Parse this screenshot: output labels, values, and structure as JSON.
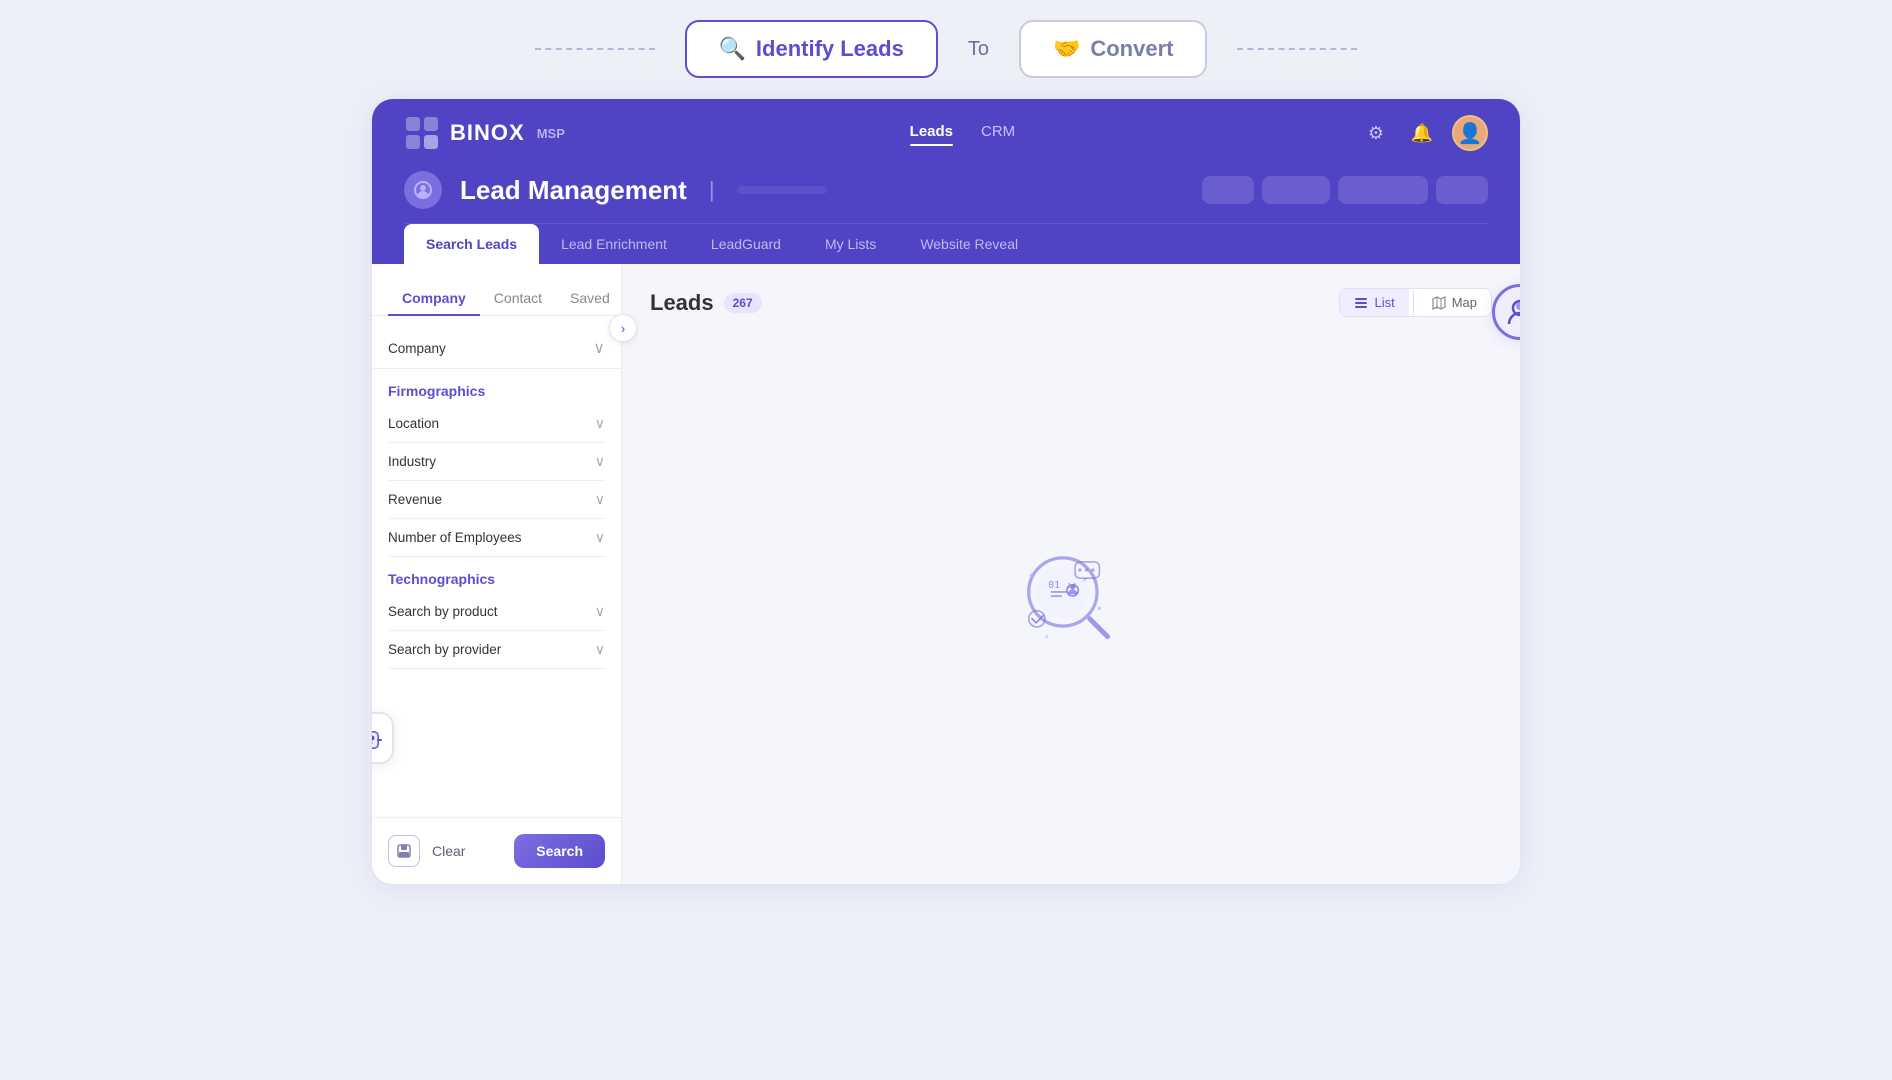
{
  "workflow": {
    "identify_label": "Identify Leads",
    "to_label": "To",
    "convert_label": "Convert"
  },
  "brand": {
    "name": "BINOX",
    "sub": "MSP"
  },
  "topnav": {
    "links": [
      {
        "label": "Leads",
        "active": true
      },
      {
        "label": "CRM",
        "active": false
      }
    ]
  },
  "page": {
    "title": "Lead Management",
    "divider": "|"
  },
  "subnav": {
    "items": [
      {
        "label": "Search Leads",
        "active": true
      },
      {
        "label": "Lead Enrichment",
        "active": false
      },
      {
        "label": "LeadGuard",
        "active": false
      },
      {
        "label": "My Lists",
        "active": false
      },
      {
        "label": "Website Reveal",
        "active": false
      }
    ]
  },
  "sidebar": {
    "tabs": [
      {
        "label": "Company",
        "active": true
      },
      {
        "label": "Contact",
        "active": false
      },
      {
        "label": "Saved",
        "active": false
      }
    ],
    "company_dropdown_label": "Company",
    "firmographics_title": "Firmographics",
    "firmographics_filters": [
      {
        "label": "Location"
      },
      {
        "label": "Industry"
      },
      {
        "label": "Revenue"
      },
      {
        "label": "Number of Employees"
      }
    ],
    "technographics_title": "Technographics",
    "technographics_filters": [
      {
        "label": "Search by product"
      },
      {
        "label": "Search by provider"
      }
    ],
    "btn_clear": "Clear",
    "btn_search": "Search"
  },
  "results": {
    "title": "Leads",
    "count": "267",
    "view_list": "List",
    "view_map": "Map"
  },
  "icons": {
    "search": "🔍",
    "handshake": "🤝",
    "gear": "⚙",
    "bell": "🔔",
    "chevron_down": "›",
    "chevron_right": "›",
    "save": "💾",
    "list": "☰",
    "map": "🗺",
    "robot": "🤖",
    "user": "👤",
    "logo_grid": "▦"
  }
}
